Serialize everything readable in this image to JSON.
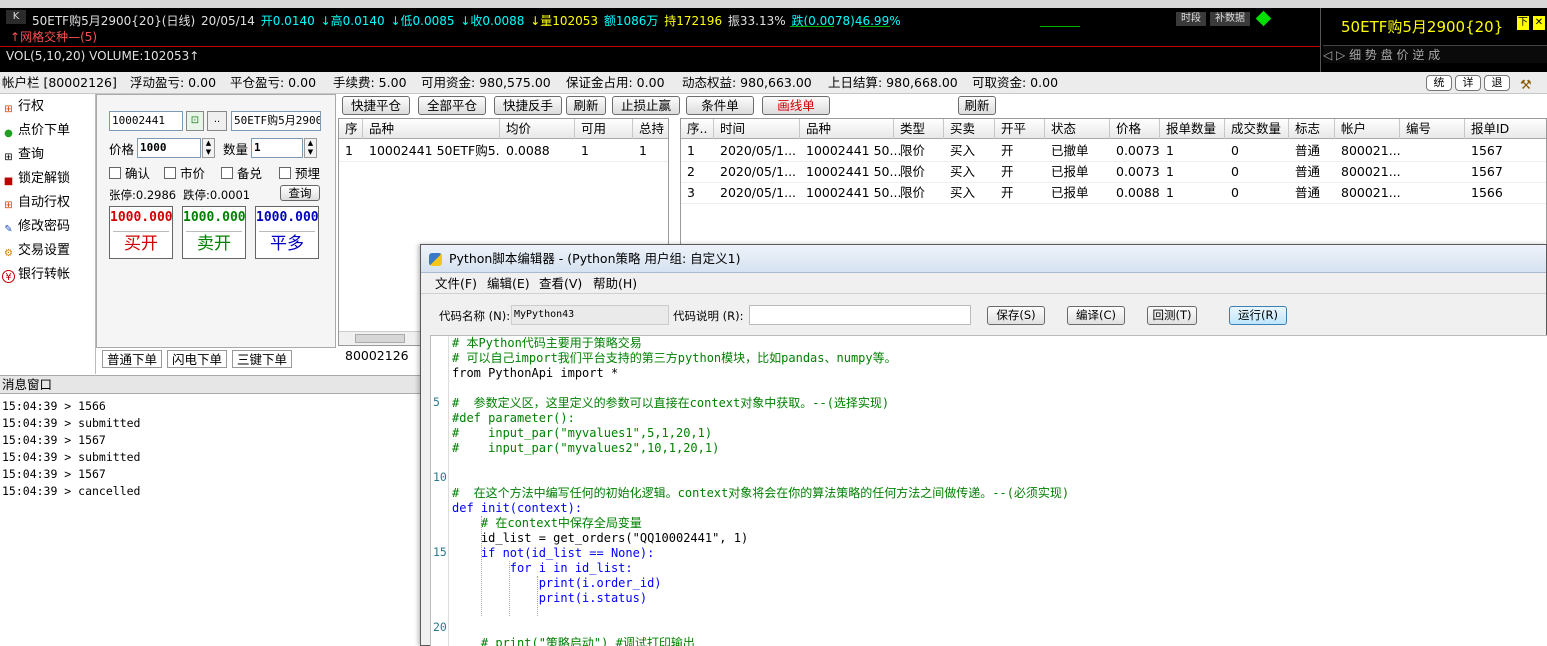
{
  "chart": {
    "k_tag": "K",
    "quote": {
      "name": "50ETF购5月2900{20}(日线)",
      "date": "20/05/14",
      "open": "开0.0140",
      "high": "↓高0.0140",
      "low": "↓低0.0085",
      "close": "↓收0.0088",
      "volume": "↓量102053",
      "amount": "额1086万",
      "hold": "持172196",
      "amplitude": "振33.13%",
      "change": "跌(0.0078)46.99%"
    },
    "grid_label": "网格交种—(5)",
    "volume_label": "VOL(5,10,20)",
    "volume_value": "VOLUME:102053↑",
    "tag_period": "时段",
    "tag_fill": "补数据",
    "right_title": "50ETF购5月2900{20}",
    "right_btn_down": "下",
    "right_btn_x": "✕",
    "right_tabs": "细 势 盘 价 逆 成"
  },
  "account": {
    "account_label": "帐户栏 [80002126]",
    "float_pnl": "浮动盈亏: 0.00",
    "close_pnl": "平仓盈亏: 0.00",
    "fee": "手续费: 5.00",
    "available": "可用资金: 980,575.00",
    "margin": "保证金占用: 0.00",
    "equity": "动态权益: 980,663.00",
    "prev_settle": "上日结算: 980,668.00",
    "withdrawable": "可取资金: 0.00",
    "btn1": "统",
    "btn2": "详",
    "btn3": "退"
  },
  "nav": {
    "items": [
      {
        "icon": "⊞",
        "label": "行权"
      },
      {
        "icon": "●",
        "label": "点价下单"
      },
      {
        "icon": "⊞",
        "label": "查询"
      },
      {
        "icon": "■",
        "label": "锁定解锁"
      },
      {
        "icon": "⊞",
        "label": "自动行权"
      },
      {
        "icon": "✎",
        "label": "修改密码"
      },
      {
        "icon": "⚙",
        "label": "交易设置"
      },
      {
        "icon": "¥",
        "label": "银行转帐"
      }
    ]
  },
  "order_form": {
    "code": "10002441",
    "lock_icon": "🔒",
    "dots": "..",
    "name": "50ETF购5月2900",
    "price_label": "价格",
    "price": "1000",
    "qty_label": "数量",
    "qty": "1",
    "confirm": "确认",
    "market": "市价",
    "covered": "备兑",
    "preorder": "预埋",
    "limit_up": "张停:0.2986",
    "limit_down": "跌停:0.0001",
    "query_btn": "查询",
    "buy_open": {
      "price": "1000.000",
      "label": "买开"
    },
    "sell_open": {
      "price": "1000.000",
      "label": "卖开"
    },
    "close_long": {
      "price": "1000.000",
      "label": "平多"
    },
    "tabs": [
      "普通下单",
      "闪电下单",
      "三键下单"
    ]
  },
  "toolbar": {
    "quick_close": "快捷平仓",
    "close_all": "全部平仓",
    "quick_reverse": "快捷反手",
    "refresh": "刷新",
    "stop": "止损止赢",
    "cond_order": "条件单",
    "line_order": "画线单",
    "refresh2": "刷新"
  },
  "positions": {
    "headers": [
      "序",
      "品种",
      "均价",
      "可用",
      "总持"
    ],
    "rows": [
      [
        "1",
        "10002441 50ETF购5...",
        "0.0088",
        "1",
        "1"
      ]
    ],
    "footer_account": "80002126"
  },
  "orders": {
    "headers": [
      "序..",
      "时间",
      "品种",
      "类型",
      "买卖",
      "开平",
      "状态",
      "价格",
      "报单数量",
      "成交数量",
      "标志",
      "帐户",
      "编号",
      "报单ID"
    ],
    "rows": [
      [
        "1",
        "2020/05/1...",
        "10002441 50...",
        "限价",
        "买入",
        "开",
        "已撤单",
        "0.0073",
        "1",
        "0",
        "普通",
        "800021...",
        "",
        "1567"
      ],
      [
        "2",
        "2020/05/1...",
        "10002441 50...",
        "限价",
        "买入",
        "开",
        "已报单",
        "0.0073",
        "1",
        "0",
        "普通",
        "800021...",
        "",
        "1567"
      ],
      [
        "3",
        "2020/05/1...",
        "10002441 50...",
        "限价",
        "买入",
        "开",
        "已报单",
        "0.0088",
        "1",
        "0",
        "普通",
        "800021...",
        "",
        "1566"
      ]
    ]
  },
  "messages": {
    "title": "消息窗口",
    "lines": [
      "15:04:39 > 1566",
      "15:04:39 > submitted",
      "15:04:39 > 1567",
      "15:04:39 > submitted",
      "15:04:39 > 1567",
      "15:04:39 > cancelled"
    ]
  },
  "editor": {
    "title": "Python脚本编辑器 - (Python策略 用户组: 自定义1)",
    "menu": [
      "文件(F)",
      "编辑(E)",
      "查看(V)",
      "帮助(H)"
    ],
    "code_name_label": "代码名称 (N):",
    "code_name_value": "MyPython43",
    "code_desc_label": "代码说明 (R):",
    "code_desc_value": "",
    "save": "保存(S)",
    "compile": "编译(C)",
    "backtest": "回测(T)",
    "run": "运行(R)",
    "line_numbers": [
      "5",
      "10",
      "15",
      "20"
    ],
    "code_lines": [
      "# 本Python代码主要用于策略交易",
      "# 可以自己import我们平台支持的第三方python模块，比如pandas、numpy等。",
      "from PythonApi import *",
      "",
      "#  参数定义区，这里定义的参数可以直接在context对象中获取。--(选择实现)",
      "#def parameter():",
      "#    input_par(\"myvalues1\",5,1,20,1)",
      "#    input_par(\"myvalues2\",10,1,20,1)",
      "",
      "",
      "#  在这个方法中编写任何的初始化逻辑。context对象将会在你的算法策略的任何方法之间做传递。--(必须实现)",
      "def init(context):",
      "    # 在context中保存全局变量",
      "    id_list = get_orders(\"QQ10002441\", 1)",
      "    if not(id_list == None):",
      "        for i in id_list:",
      "            print(i.order_id)",
      "            print(i.status)",
      "",
      "",
      "    # print(\"策略启动\") #调试打印输出"
    ]
  }
}
